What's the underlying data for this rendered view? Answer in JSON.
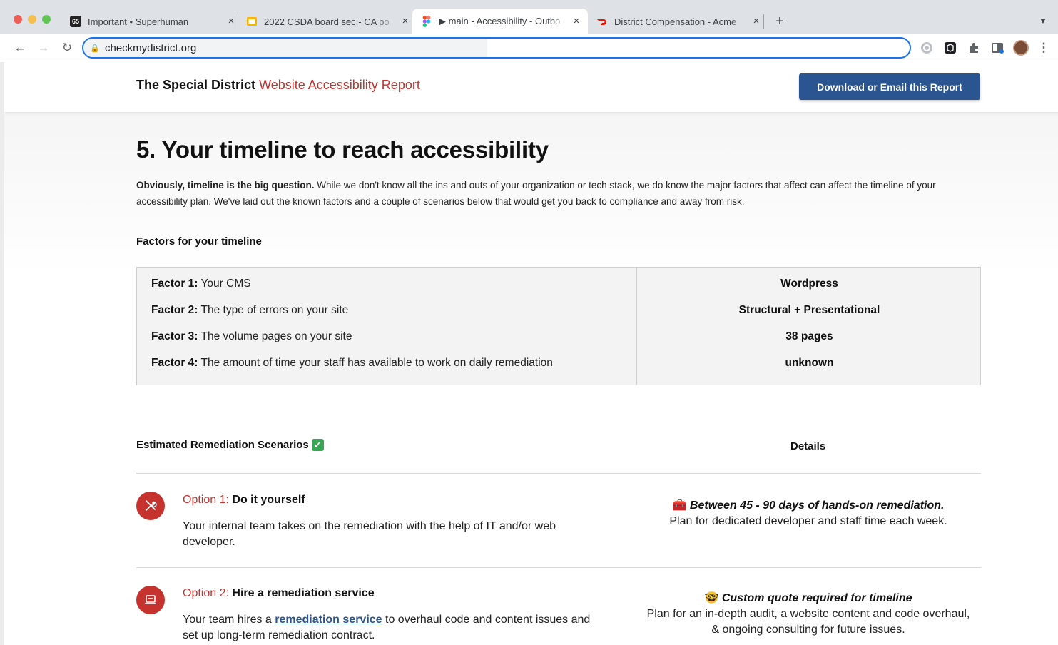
{
  "browser": {
    "tabs": [
      {
        "title": "Important • Superhuman",
        "favicon": "superhuman-icon",
        "badge": "65"
      },
      {
        "title": "2022 CSDA board sec - CA po",
        "favicon": "slides-icon"
      },
      {
        "title": "▶ main - Accessibility - Outbo",
        "favicon": "figma-icon"
      },
      {
        "title": "District Compensation - Acme",
        "favicon": "doordash-icon"
      }
    ],
    "url": "checkmydistrict.org"
  },
  "header": {
    "brand_plain": "The Special District",
    "brand_accent": "Website Accessibility Report",
    "download_label": "Download or Email this Report"
  },
  "section": {
    "title": "5. Your timeline to reach accessibility",
    "intro_bold": "Obviously, timeline is the big question.",
    "intro_rest": " While we don't know all the ins and outs of your organization or tech stack, we do know the major factors that affect can affect the timeline of your accessibility plan. We've laid out the known factors and a couple of scenarios below that would get you back to compliance and away from risk."
  },
  "factors": {
    "title": "Factors for your timeline",
    "rows": [
      {
        "label": "Factor 1:",
        "text": " Your CMS",
        "value": "Wordpress"
      },
      {
        "label": "Factor 2:",
        "text": " The type of errors on your site",
        "value": "Structural + Presentational"
      },
      {
        "label": "Factor 3:",
        "text": " The volume pages on your site",
        "value": "38 pages"
      },
      {
        "label": "Factor 4:",
        "text": " The amount of time your staff has available to work on daily remediation",
        "value": "unknown"
      }
    ]
  },
  "scenarios": {
    "title": "Estimated Remediation Scenarios",
    "details_title": "Details",
    "options": [
      {
        "num": "Option 1:",
        "name": " Do it yourself",
        "desc": "Your internal team takes on the remediation with the help of IT and/or web developer.",
        "detail_emoji": "🧰",
        "detail_em": "Between 45 - 90 days of hands-on remediation.",
        "detail_text": "Plan for dedicated developer and staff time each week."
      },
      {
        "num": "Option 2:",
        "name": " Hire a remediation service",
        "desc_before": "Your team hires a ",
        "desc_link": "remediation service",
        "desc_after": " to overhaul code and content issues and set up long-term remediation contract.",
        "detail_emoji": "🤓",
        "detail_em": "Custom quote required for timeline",
        "detail_text": "Plan for an in-depth audit, a website content and code overhaul, & ongoing consulting for future issues."
      }
    ]
  },
  "colors": {
    "accent_red": "#c6332f",
    "button_blue": "#2b5591",
    "focus_blue": "#1a73e8"
  }
}
